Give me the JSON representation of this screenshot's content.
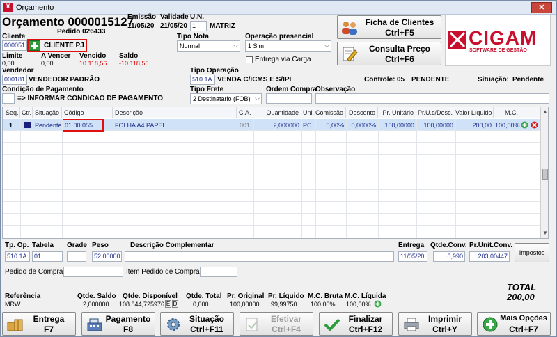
{
  "window": {
    "title": "Orçamento",
    "close": "✕"
  },
  "header": {
    "title": "Orçamento 0000015127",
    "pedido": "Pedido 026433",
    "emissao_label": "Emissão",
    "emissao": "11/05/20",
    "validade_label": "Validade",
    "validade": "21/05/20",
    "un_label": "U.N.",
    "un_value": "1",
    "un_name": "MATRIZ"
  },
  "cliente": {
    "label": "Cliente",
    "code": "000051",
    "name": "CLIENTE PJ"
  },
  "tipo_nota": {
    "label": "Tipo Nota",
    "value": "Normal"
  },
  "operacao_presencial": {
    "label": "Operação presencial",
    "value": "1 Sim"
  },
  "entrega_via_carga": {
    "label": "Entrega via Carga"
  },
  "financeiro": {
    "limite_label": "Limite",
    "limite": "0,00",
    "avencer_label": "A Vencer",
    "avencer": "0,00",
    "vencido_label": "Vencido",
    "vencido": "10.118,56",
    "saldo_label": "Saldo",
    "saldo": "-10.118,56"
  },
  "vendedor": {
    "label": "Vendedor",
    "code": "000181",
    "name": "VENDEDOR PADRÃO"
  },
  "tipo_operacao": {
    "label": "Tipo Operação",
    "code": "510.1A",
    "name": "VENDA C/ICMS E S/IPI"
  },
  "controle": {
    "label": "Controle:",
    "value": "05",
    "status": "PENDENTE"
  },
  "situacao": {
    "label": "Situação:",
    "value": "Pendente"
  },
  "condicao": {
    "label": "Condição de Pagamento",
    "value": "=> INFORMAR CONDICAO DE PAGAMENTO"
  },
  "tipo_frete": {
    "label": "Tipo Frete",
    "value": "2 Destinatario (FOB)"
  },
  "ordem_compra": {
    "label": "Ordem Compra"
  },
  "observacao": {
    "label": "Observação"
  },
  "buttons": {
    "ficha_l1": "Ficha de Clientes",
    "ficha_l2": "Ctrl+F5",
    "consulta_l1": "Consulta Preço",
    "consulta_l2": "Ctrl+F6"
  },
  "logo": {
    "text": "CIGAM",
    "sub": "SOFTWARE DE GESTÃO"
  },
  "grid": {
    "columns": [
      "Seq.",
      "Ctr.",
      "Situação",
      "Código",
      "Descrição",
      "C.A.",
      "Quantidade",
      "Uni.",
      "Comissão",
      "Desconto",
      "Pr. Unitário",
      "Pr.U.c/Desc.",
      "Valor Líquido",
      "M.C."
    ],
    "rows": [
      {
        "seq": "1",
        "situacao": "Pendente",
        "codigo": "01.00.055",
        "descricao": "FOLHA A4 PAPEL",
        "ca": "001",
        "quantidade": "2,000000",
        "uni": "PC",
        "comissao": "0,00%",
        "desconto": "0,0000%",
        "pr_unit": "100,00000",
        "pr_desc": "100,00000",
        "valor": "200,00",
        "mc": "100,00%"
      }
    ]
  },
  "item": {
    "tpop_label": "Tp. Op.",
    "tpop": "510.1A",
    "tabela_label": "Tabela",
    "tabela": "01",
    "grade_label": "Grade",
    "peso_label": "Peso",
    "peso": "52,00000",
    "desc_comp_label": "Descrição Complementar",
    "entrega_label": "Entrega",
    "entrega": "11/05/20",
    "qtde_conv_label": "Qtde.Conv.",
    "qtde_conv": "0,990",
    "pr_unit_conv_label": "Pr.Unit.Conv.",
    "pr_unit_conv": "203,00447",
    "impostos": "Impostos",
    "pedido_compra_label": "Pedido de Compra",
    "item_pedido_label": "Item Pedido de Compra"
  },
  "totals": {
    "total_label": "TOTAL",
    "total": "200,00",
    "referencia_label": "Referência",
    "referencia": "MRW",
    "qtde_saldo_label": "Qtde. Saldo",
    "qtde_saldo": "2,000000",
    "qtde_disp_label": "Qtde. Disponível",
    "qtde_disp": "108.844,725976",
    "e_btn": "E",
    "d_btn": "D",
    "qtde_total_label": "Qtde. Total",
    "qtde_total": "0,000",
    "pr_original_label": "Pr. Original",
    "pr_original": "100,00000",
    "pr_liquido_label": "Pr. Líquido",
    "pr_liquido": "99,99750",
    "mc_bruta_label": "M.C. Bruta",
    "mc_bruta": "100,00%",
    "mc_liquida_label": "M.C. Líquida",
    "mc_liquida": "100,00%"
  },
  "bottom": {
    "entrega_l1": "Entrega",
    "entrega_l2": "F7",
    "pagamento_l1": "Pagamento",
    "pagamento_l2": "F8",
    "situacao_l1": "Situação",
    "situacao_l2": "Ctrl+F11",
    "efetivar_l1": "Efetivar",
    "efetivar_l2": "Ctrl+F4",
    "finalizar_l1": "Finalizar",
    "finalizar_l2": "Ctrl+F12",
    "imprimir_l1": "Imprimir",
    "imprimir_l2": "Ctrl+Y",
    "mais_l1": "Mais Opções",
    "mais_l2": "Ctrl+F7"
  },
  "colors": {
    "accent_red": "#c8102e",
    "value_blue": "#1b2a8a",
    "warn_red": "#d40000"
  }
}
